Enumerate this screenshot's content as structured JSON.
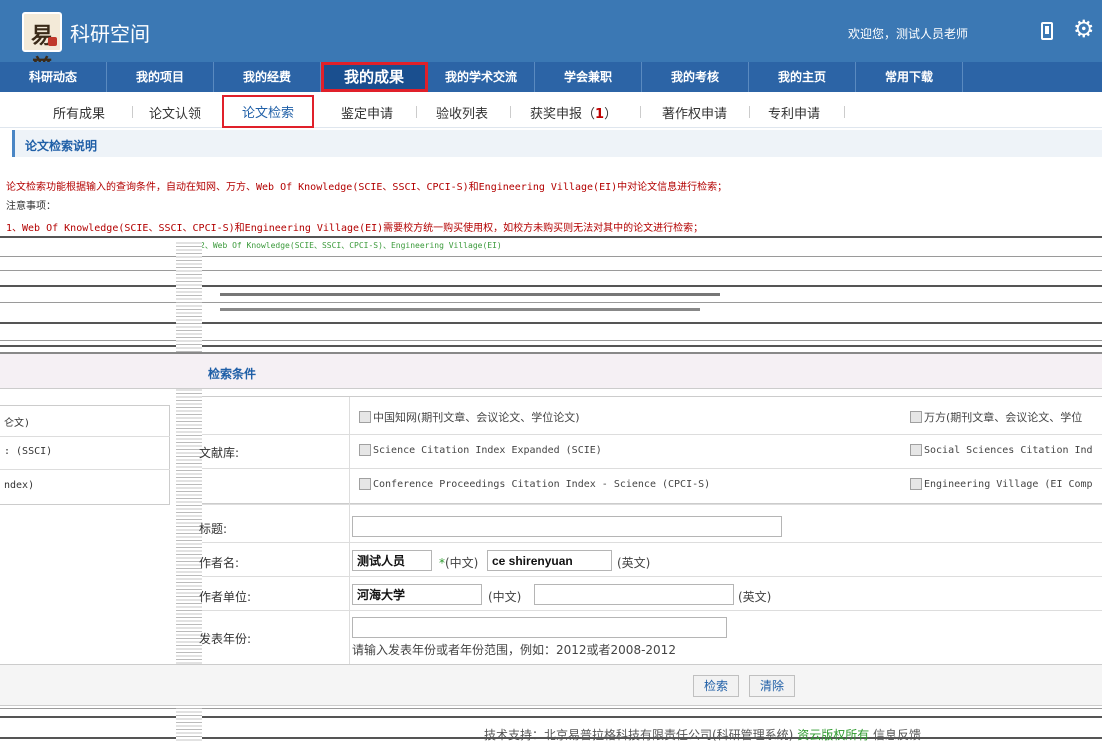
{
  "header": {
    "app_title": "科研空间",
    "welcome": "欢迎您，测试人员老师",
    "logo_text": "易普"
  },
  "main_nav": [
    {
      "label": "科研动态"
    },
    {
      "label": "我的项目"
    },
    {
      "label": "我的经费"
    },
    {
      "label": "我的成果",
      "active": true
    },
    {
      "label": "我的学术交流"
    },
    {
      "label": "学会兼职"
    },
    {
      "label": "我的考核"
    },
    {
      "label": "我的主页"
    },
    {
      "label": "常用下载"
    }
  ],
  "sub_nav": {
    "items": [
      "所有成果",
      "论文认领",
      "论文检索",
      "鉴定申请",
      "验收列表",
      "获奖申报",
      "著作权申请",
      "专利申请"
    ],
    "award_count": "1",
    "active": "论文检索"
  },
  "notice": {
    "title": "论文检索说明",
    "line1": "论文检索功能根据输入的查询条件，自动在知网、万方、Web Of Knowledge(SCIE、SSCI、CPCI-S)和Engineering Village(EI)中对论文信息进行检索；",
    "line2": "注意事项：",
    "line3": "1、Web Of Knowledge(SCIE、SSCI、CPCI-S)和Engineering Village(EI)需要校方统一购买使用权，如校方未购买则无法对其中的论文进行检索；",
    "line4": "2、Web Of Knowledge(SCIE、SSCI、CPCI-S)、Engineering Village(EI)"
  },
  "search": {
    "section_title": "检索条件",
    "db_label": "文献库:",
    "databases": {
      "cnki": "中国知网(期刊文章、会议论文、学位论文)",
      "wanfang": "万方(期刊文章、会议论文、学位",
      "scie": "Science Citation Index Expanded (SCIE)",
      "ssci": "Social Sciences Citation Ind",
      "cpci": "Conference Proceedings Citation Index - Science (CPCI-S)",
      "ei": "Engineering Village (EI Comp"
    },
    "left_fragments": [
      "仑文)",
      ": (SSCI)",
      "ndex)"
    ],
    "title_label": "标题:",
    "title_value": "",
    "author_label": "作者名:",
    "author_cn": "测试人员",
    "author_cn_hint": "(中文)",
    "author_en": "ce shirenyuan",
    "author_en_hint": "(英文)",
    "required_mark": "*",
    "org_label": "作者单位:",
    "org_cn": "河海大学",
    "org_cn_hint": "(中文)",
    "org_en": "",
    "org_en_hint": "(英文)",
    "year_label": "发表年份:",
    "year_value": "",
    "year_hint": "请输入发表年份或者年份范围，例如：2012或者2008-2012",
    "search_button": "检索",
    "clear_button": "清除"
  },
  "footer": {
    "support": "技术支持：北京易普拉格科技有限责任公司(科研管理系统)",
    "link": "资云版权所有",
    "feedback": "信息反馈"
  }
}
